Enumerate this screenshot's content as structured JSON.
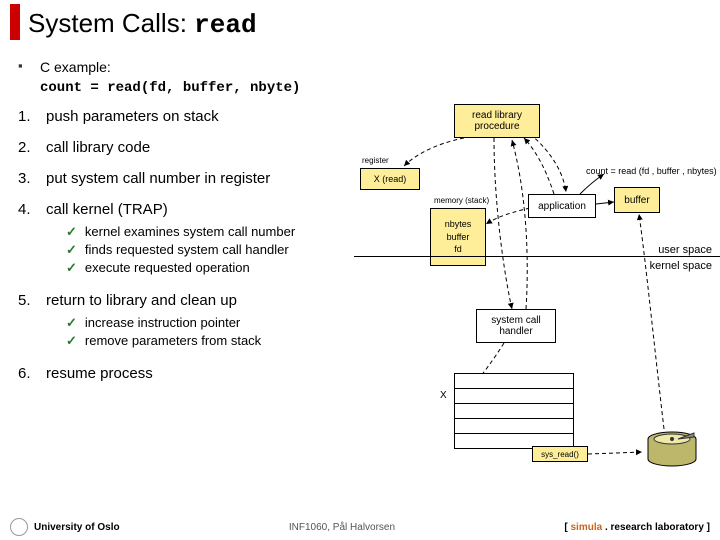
{
  "title_prefix": "System Calls: ",
  "title_mono": "read",
  "intro_label": "C example:",
  "intro_code": "count = read(fd, buffer, nbyte)",
  "steps": [
    {
      "text": "push parameters on stack",
      "sub": []
    },
    {
      "text": "call library code",
      "sub": []
    },
    {
      "text": "put system call number in register",
      "sub": []
    },
    {
      "text": "call kernel (TRAP)",
      "sub": [
        "kernel examines system call number",
        "finds requested system call handler",
        "execute requested operation"
      ]
    },
    {
      "text": "return to library and clean up",
      "sub": [
        "increase instruction pointer",
        "remove parameters from stack"
      ]
    },
    {
      "text": "resume process",
      "sub": []
    }
  ],
  "diag": {
    "lib": "read library procedure",
    "reg_lbl": "register",
    "reg_val": "X (read)",
    "mem_lbl": "memory (stack)",
    "mem_rows": [
      "nbytes",
      "buffer",
      "fd"
    ],
    "app": "application",
    "buffer": "buffer",
    "count_code": "count = read (fd , buffer , nbytes)",
    "user_space": "user space",
    "kernel_space": "kernel space",
    "sch": "system call handler",
    "kx": "X",
    "sysread": "sys_read()"
  },
  "footer": {
    "uio": "University of Oslo",
    "center": "INF1060, Pål Halvorsen",
    "simula_pre": "[ ",
    "simula_brand": "simula",
    "simula_post": " . research laboratory ]"
  }
}
